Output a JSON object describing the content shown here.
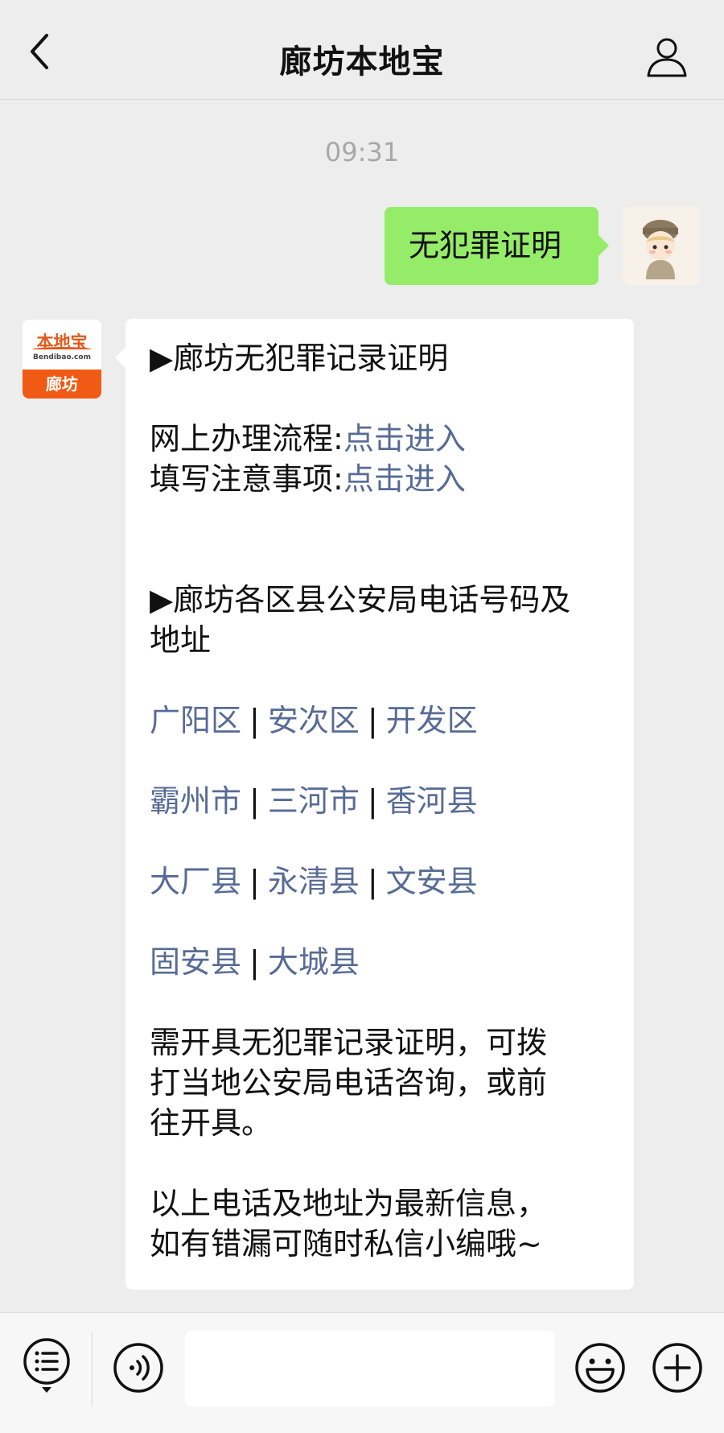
{
  "header": {
    "title": "廊坊本地宝"
  },
  "chat": {
    "time": "09:31",
    "outgoing_text": "无犯罪证明",
    "incoming_avatar": {
      "brand": "本地宝",
      "site": "Bendibao.com",
      "city": "廊坊"
    },
    "incoming": {
      "heading1": "▶廊坊无犯罪记录证明",
      "online_label": "网上办理流程:",
      "online_link": "点击进入",
      "notes_label": "填写注意事项:",
      "notes_link": "点击进入",
      "heading2_line1": "▶廊坊各区县公安局电话号码及",
      "heading2_line2": "地址",
      "separator": "|",
      "districts": [
        [
          "广阳区",
          "安次区",
          "开发区"
        ],
        [
          "霸州市",
          "三河市",
          "香河县"
        ],
        [
          "大厂县",
          "永清县",
          "文安县"
        ],
        [
          "固安县",
          "大城县"
        ]
      ],
      "para1": [
        "需开具无犯罪记录证明，可拨",
        "打当地公安局电话咨询，或前",
        "往开具。"
      ],
      "para2": [
        "以上电话及地址为最新信息，",
        "如有错漏可随时私信小编哦~"
      ]
    }
  },
  "input_bar": {
    "placeholder": ""
  },
  "colors": {
    "background": "#ededed",
    "outgoing_bubble": "#95ec69",
    "incoming_bubble": "#ffffff",
    "link": "#576b95",
    "brand_orange": "#f05a14"
  }
}
